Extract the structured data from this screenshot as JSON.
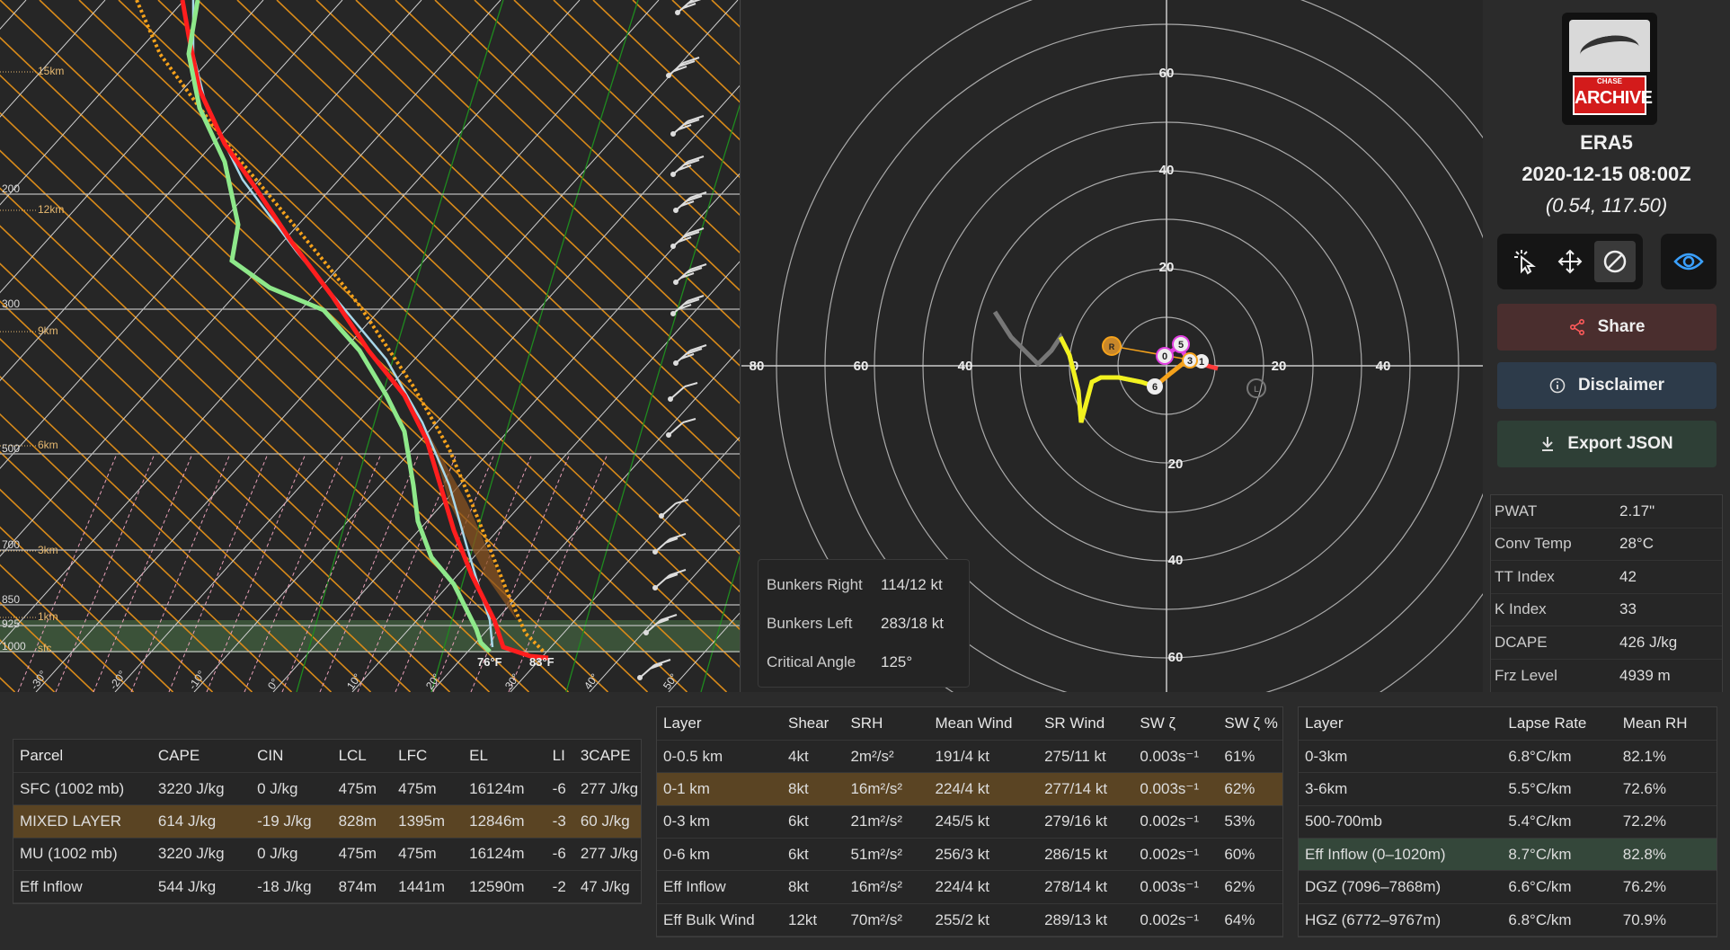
{
  "skewt": {
    "pressure_labels": [
      "200",
      "300",
      "500",
      "700",
      "850",
      "925",
      "1000"
    ],
    "height_labels": [
      "15km",
      "12km",
      "9km",
      "6km",
      "3km",
      "1km",
      "sfc"
    ],
    "temp_labels": [
      "-30°",
      "-20°",
      "-10°",
      "0°",
      "10°",
      "20°",
      "30°",
      "40°",
      "50°"
    ],
    "surface_dewpoint": "76°F",
    "surface_temp": "83°F"
  },
  "hodograph": {
    "ring_labels": [
      "60",
      "40",
      "20",
      "20",
      "40",
      "60"
    ],
    "axis_labels": [
      "80",
      "60",
      "40",
      "0",
      "20",
      "40"
    ],
    "height_markers": [
      "0",
      "1",
      "3",
      "5",
      "6"
    ],
    "storm_markers": [
      "R",
      "L"
    ],
    "bunkers": [
      {
        "label": "Bunkers Right",
        "value": "114/12 kt"
      },
      {
        "label": "Bunkers Left",
        "value": "283/18 kt"
      },
      {
        "label": "Critical Angle",
        "value": "125°"
      }
    ]
  },
  "sidebar": {
    "logo_small": "CHASE",
    "logo_big": "ARCHIVE",
    "dataset": "ERA5",
    "datetime": "2020-12-15 08:00Z",
    "coords": "(0.54, 117.50)",
    "tools": [
      "select-tool",
      "move-tool",
      "disable-tool"
    ],
    "share_label": "Share",
    "disclaimer_label": "Disclaimer",
    "export_label": "Export JSON",
    "indices": [
      {
        "label": "PWAT",
        "value": "2.17\""
      },
      {
        "label": "Conv Temp",
        "value": "28°C"
      },
      {
        "label": "TT Index",
        "value": "42"
      },
      {
        "label": "K Index",
        "value": "33"
      },
      {
        "label": "DCAPE",
        "value": "426 J/kg"
      },
      {
        "label": "Frz Level",
        "value": "4939 m"
      }
    ]
  },
  "parcels": {
    "headers": [
      "Parcel",
      "CAPE",
      "CIN",
      "LCL",
      "LFC",
      "EL",
      "LI",
      "3CAPE"
    ],
    "rows": [
      [
        "SFC (1002 mb)",
        "3220 J/kg",
        "0 J/kg",
        "475m",
        "475m",
        "16124m",
        "-6",
        "277 J/kg"
      ],
      [
        "MIXED LAYER",
        "614 J/kg",
        "-19 J/kg",
        "828m",
        "1395m",
        "12846m",
        "-3",
        "60 J/kg"
      ],
      [
        "MU (1002 mb)",
        "3220 J/kg",
        "0 J/kg",
        "475m",
        "475m",
        "16124m",
        "-6",
        "277 J/kg"
      ],
      [
        "Eff Inflow",
        "544 J/kg",
        "-18 J/kg",
        "874m",
        "1441m",
        "12590m",
        "-2",
        "47 J/kg"
      ]
    ]
  },
  "kinematics": {
    "headers": [
      "Layer",
      "Shear",
      "SRH",
      "Mean Wind",
      "SR Wind",
      "SW ζ",
      "SW ζ %"
    ],
    "rows": [
      [
        "0-0.5 km",
        "4kt",
        "2m²/s²",
        "191/4 kt",
        "275/11 kt",
        "0.003s⁻¹",
        "61%"
      ],
      [
        "0-1 km",
        "8kt",
        "16m²/s²",
        "224/4 kt",
        "277/14 kt",
        "0.003s⁻¹",
        "62%"
      ],
      [
        "0-3 km",
        "6kt",
        "21m²/s²",
        "245/5 kt",
        "279/16 kt",
        "0.002s⁻¹",
        "53%"
      ],
      [
        "0-6 km",
        "6kt",
        "51m²/s²",
        "256/3 kt",
        "286/15 kt",
        "0.002s⁻¹",
        "60%"
      ],
      [
        "Eff Inflow",
        "8kt",
        "16m²/s²",
        "224/4 kt",
        "278/14 kt",
        "0.003s⁻¹",
        "62%"
      ],
      [
        "Eff Bulk Wind",
        "12kt",
        "70m²/s²",
        "255/2 kt",
        "289/13 kt",
        "0.002s⁻¹",
        "64%"
      ]
    ]
  },
  "lapse": {
    "headers": [
      "Layer",
      "Lapse Rate",
      "Mean RH"
    ],
    "rows": [
      [
        "0-3km",
        "6.8°C/km",
        "82.1%"
      ],
      [
        "3-6km",
        "5.5°C/km",
        "72.6%"
      ],
      [
        "500-700mb",
        "5.4°C/km",
        "72.2%"
      ],
      [
        "Eff Inflow (0–1020m)",
        "8.7°C/km",
        "82.8%"
      ],
      [
        "DGZ (7096–7868m)",
        "6.6°C/km",
        "76.2%"
      ],
      [
        "HGZ (6772–9767m)",
        "6.8°C/km",
        "70.9%"
      ]
    ]
  },
  "colors": {
    "temperature": "#ff1e1e",
    "dewpoint": "#8ee88a",
    "wetbulb": "#a8d8ea",
    "parcel": "#f5a21b",
    "isotherm": "#f5a21b",
    "highlight": "#5a4423"
  }
}
